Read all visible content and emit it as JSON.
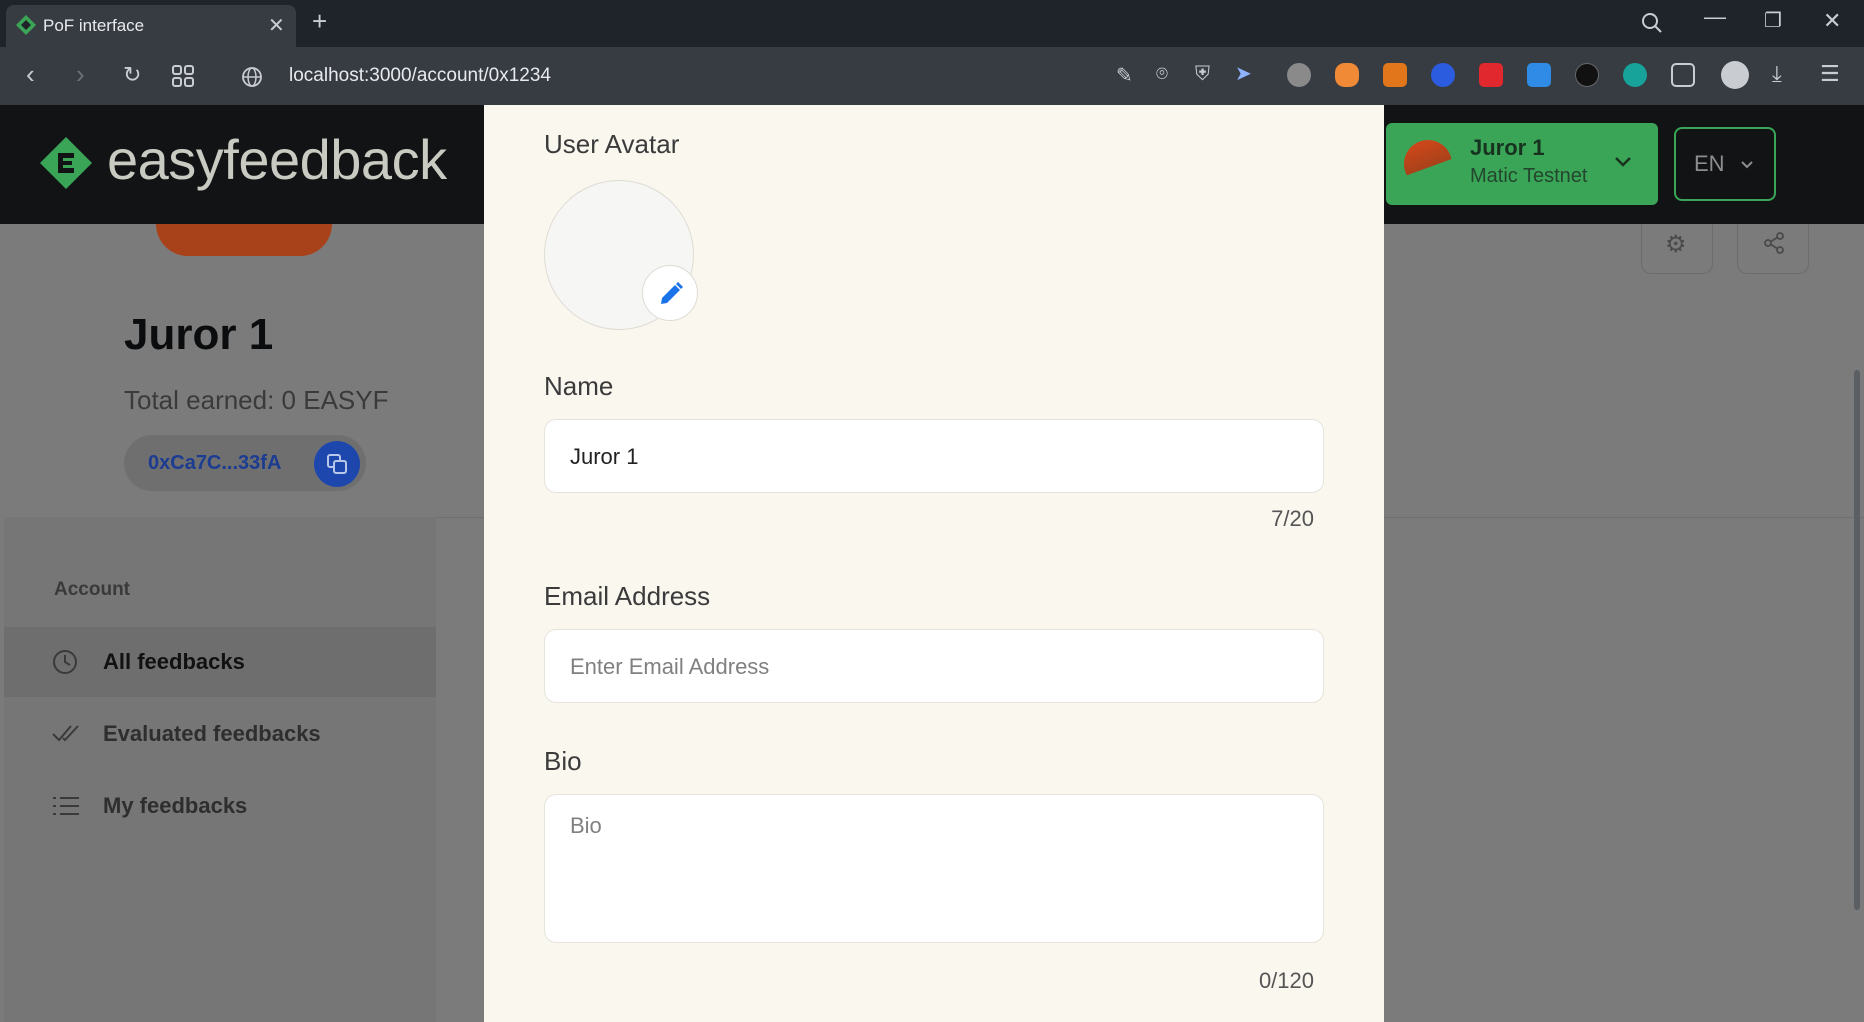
{
  "browser": {
    "tab_title": "PoF interface",
    "url": "localhost:3000/account/0x1234"
  },
  "site": {
    "logo_text": "easyfeedback",
    "wallet": {
      "name": "Juror 1",
      "network": "Matic Testnet"
    },
    "language": "EN"
  },
  "profile": {
    "name": "Juror 1",
    "total_earned": "Total earned: 0 EASYF",
    "address": "0xCa7C...33fA"
  },
  "sidebar": {
    "title": "Account",
    "items": [
      {
        "label": "All feedbacks",
        "icon": "clock-icon",
        "active": true
      },
      {
        "label": "Evaluated feedbacks",
        "icon": "double-check-icon",
        "active": false
      },
      {
        "label": "My feedbacks",
        "icon": "list-icon",
        "active": false
      }
    ]
  },
  "modal": {
    "avatar_label": "User Avatar",
    "name_label": "Name",
    "name_value": "Juror 1",
    "name_counter": "7/20",
    "email_label": "Email Address",
    "email_placeholder": "Enter Email Address",
    "bio_label": "Bio",
    "bio_placeholder": "Bio",
    "bio_counter": "0/120"
  },
  "colors": {
    "brand_green": "#3aa557",
    "accent_blue": "#1d47ad",
    "modal_bg": "#faf7ef"
  }
}
